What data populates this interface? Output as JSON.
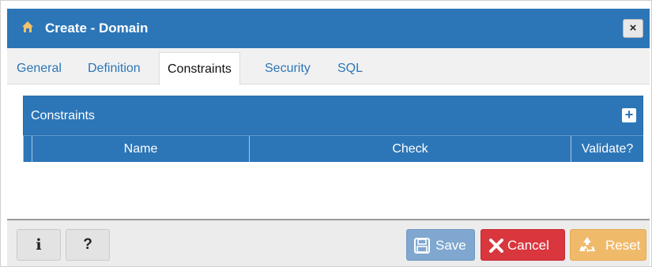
{
  "dialog": {
    "title": "Create - Domain",
    "close_label": "×"
  },
  "tabs": [
    {
      "label": "General",
      "active": false
    },
    {
      "label": "Definition",
      "active": false
    },
    {
      "label": "Constraints",
      "active": true
    },
    {
      "label": "Security",
      "active": false
    },
    {
      "label": "SQL",
      "active": false
    }
  ],
  "constraints_panel": {
    "title": "Constraints",
    "add_label": "+",
    "columns": [
      "Name",
      "Check",
      "Validate?"
    ],
    "rows": []
  },
  "footer": {
    "info_label": "i",
    "help_label": "?",
    "save_label": "Save",
    "cancel_label": "Cancel",
    "reset_label": "Reset"
  },
  "icons": {
    "title": "home-icon",
    "save": "floppy-disk-icon",
    "cancel": "x-mark-icon",
    "reset": "recycle-icon"
  },
  "colors": {
    "primary": "#2c76b8",
    "save": "#7fa7cf",
    "cancel": "#d9363e",
    "reset": "#f0ba6b"
  }
}
